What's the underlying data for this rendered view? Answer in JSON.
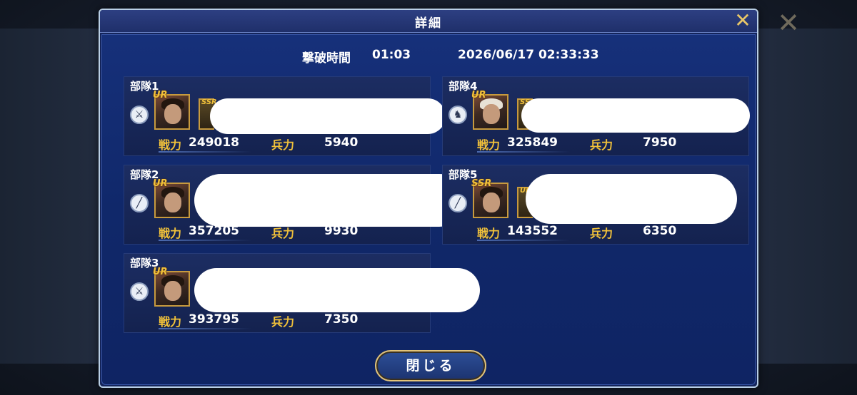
{
  "dialog": {
    "title": "詳細",
    "close_icon": "✕"
  },
  "battle_info": {
    "defeat_time_label": "撃破時間",
    "defeat_time_value": "01:03",
    "datetime": "2026/06/17  02:33:33"
  },
  "stat_labels": {
    "power": "戦力",
    "troops": "兵力"
  },
  "units": [
    {
      "name": "部隊1",
      "rarity": "UR",
      "rarity_mark": "大",
      "sub_rarity": "SSR",
      "type_icon": "sword-icon",
      "power": "249018",
      "troops": "5940"
    },
    {
      "name": "部隊2",
      "rarity": "UR",
      "rarity_mark": "大",
      "sub_rarity": "",
      "type_icon": "spear-icon",
      "power": "357205",
      "troops": "9930"
    },
    {
      "name": "部隊3",
      "rarity": "UR",
      "rarity_mark": "大",
      "sub_rarity": "",
      "type_icon": "sword-icon",
      "power": "393795",
      "troops": "7350"
    },
    {
      "name": "部隊4",
      "rarity": "UR",
      "rarity_mark": "大",
      "sub_rarity": "SSR",
      "type_icon": "horse-icon",
      "power": "325849",
      "troops": "7950"
    },
    {
      "name": "部隊5",
      "rarity": "SSR",
      "rarity_mark": "大",
      "sub_rarity": "UR",
      "type_icon": "spear-icon",
      "power": "143552",
      "troops": "6350"
    }
  ],
  "footer": {
    "close_button_label": "閉じる"
  },
  "colors": {
    "modal_bg": "#14245a",
    "gold_accent": "#f2c23a",
    "close_x": "#e8c668"
  }
}
